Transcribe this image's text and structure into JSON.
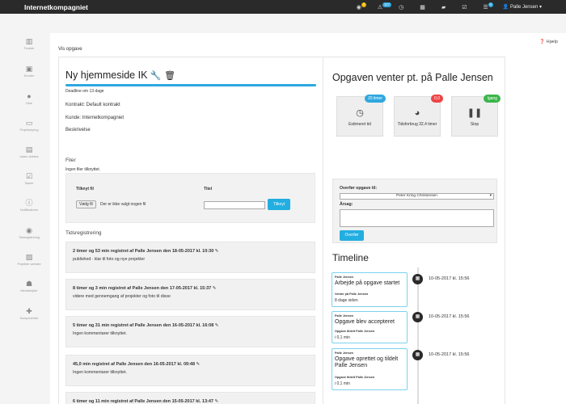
{
  "topbar": {
    "brand": "Internetkompagniet",
    "badges": [
      {
        "icon": "coins-icon",
        "count": "0",
        "color": "#e6b400"
      },
      {
        "icon": "warning-icon",
        "count": "117",
        "color": "#2ea8e0"
      },
      {
        "icon": "clock-icon",
        "count": ""
      },
      {
        "icon": "calendar-icon",
        "count": ""
      },
      {
        "icon": "send-icon",
        "count": ""
      },
      {
        "icon": "check-icon",
        "count": ""
      },
      {
        "icon": "list-icon",
        "count": "0",
        "color": "#2ea8e0"
      }
    ],
    "user": "Palle Jensen ▾"
  },
  "sidebar": {
    "items": [
      {
        "label": "Forside",
        "icon": "chart-icon"
      },
      {
        "label": "Kunder",
        "icon": "money-icon"
      },
      {
        "label": "Dine",
        "icon": "user-icon"
      },
      {
        "label": "Projektstyring",
        "icon": "folder-icon"
      },
      {
        "label": "Udarv dokkes",
        "icon": "book-icon"
      },
      {
        "label": "Tasker",
        "icon": "checkbox-icon"
      },
      {
        "label": "Notifikationer",
        "icon": "info-icon"
      },
      {
        "label": "Tidsregistrering",
        "icon": "coins-icon"
      },
      {
        "label": "Projekter website",
        "icon": "image-icon"
      },
      {
        "label": "Medarbejder",
        "icon": "group-icon"
      },
      {
        "label": "Komponenter",
        "icon": "puzzle-icon"
      }
    ]
  },
  "page": {
    "help": "Hjælp",
    "vis": "Vis opgave"
  },
  "task": {
    "title": "Ny hjemmeside IK",
    "deadline": "Deadline om 13 dage",
    "contract": "Kontrakt: Default kontrakt",
    "customer": "Kunde: Internetkompagniet",
    "description": "Beskrivelse"
  },
  "files": {
    "heading": "Filer",
    "none": "Ingen filer tilknyttet.",
    "col_file": "Tilknyt fil",
    "col_title": "Titel",
    "choose": "Vælg fil",
    "nofile": "Der er ikke valgt nogen fil",
    "attach": "Tilknyt"
  },
  "time": {
    "heading": "Tidsregistrering",
    "entries": [
      {
        "head": "2 timer og 53 min registret af Palle Jensen den 18-05-2017 kl. 10:30 ✎",
        "body": "published - klar til foto og nye projekter"
      },
      {
        "head": "8 timer og 3 min registret af Palle Jensen den 17-05-2017 kl. 15:37 ✎",
        "body": "videre med gennemgang af projekter og foto til disse"
      },
      {
        "head": "5 timer og 31 min registret af Palle Jensen den 16-05-2017 kl. 16:08 ✎",
        "body": "Ingen kommentarer tilknyttet."
      },
      {
        "head": "45,0 min registret af Palle Jensen den 16-05-2017 kl. 09:48 ✎",
        "body": "Ingen kommentarer tilknyttet."
      },
      {
        "head": "6 timer og 11 min registret af Palle Jensen den 15-05-2017 kl. 13:47 ✎",
        "body": ""
      }
    ]
  },
  "status": {
    "title": "Opgaven venter pt. på Palle Jensen",
    "cards": [
      {
        "label": "Estimeret tid",
        "badge": "20 timer",
        "badge_color": "#2ea8e0",
        "icon": "clock-icon"
      },
      {
        "label": "Tidsforbrug 32,4 timer",
        "badge": "0,0",
        "badge_color": "#e44",
        "icon": "dashboard-icon"
      },
      {
        "label": "Stop",
        "badge": "Igang",
        "badge_color": "#3bb54a",
        "icon": "pause-icon"
      }
    ]
  },
  "transfer": {
    "label": "Overfør opgave til:",
    "selected": "Peter Kring Christensen",
    "reason": "Årsag:",
    "button": "Overfør"
  },
  "timeline": {
    "title": "Timeline",
    "events": [
      {
        "by": "Palle Jensen",
        "heading": "Arbejde på opgave startet",
        "sub": "Venter på Palle Jensen",
        "text": "8 dage siden",
        "date": "10-05-2017 kl. 15:56"
      },
      {
        "by": "Palle Jensen",
        "heading": "Opgave blev accepteret",
        "sub": "Opgave tildelt Palle Jensen",
        "text": "i 0,1 min",
        "date": "10-05-2017 kl. 15:56"
      },
      {
        "by": "Palle Jensen",
        "heading": "Opgave oprettet og tildelt Palle Jensen",
        "sub": "Opgave tildelt Palle Jensen",
        "text": "i 0,1 min",
        "date": "10-05-2017 kl. 15:56"
      }
    ]
  }
}
